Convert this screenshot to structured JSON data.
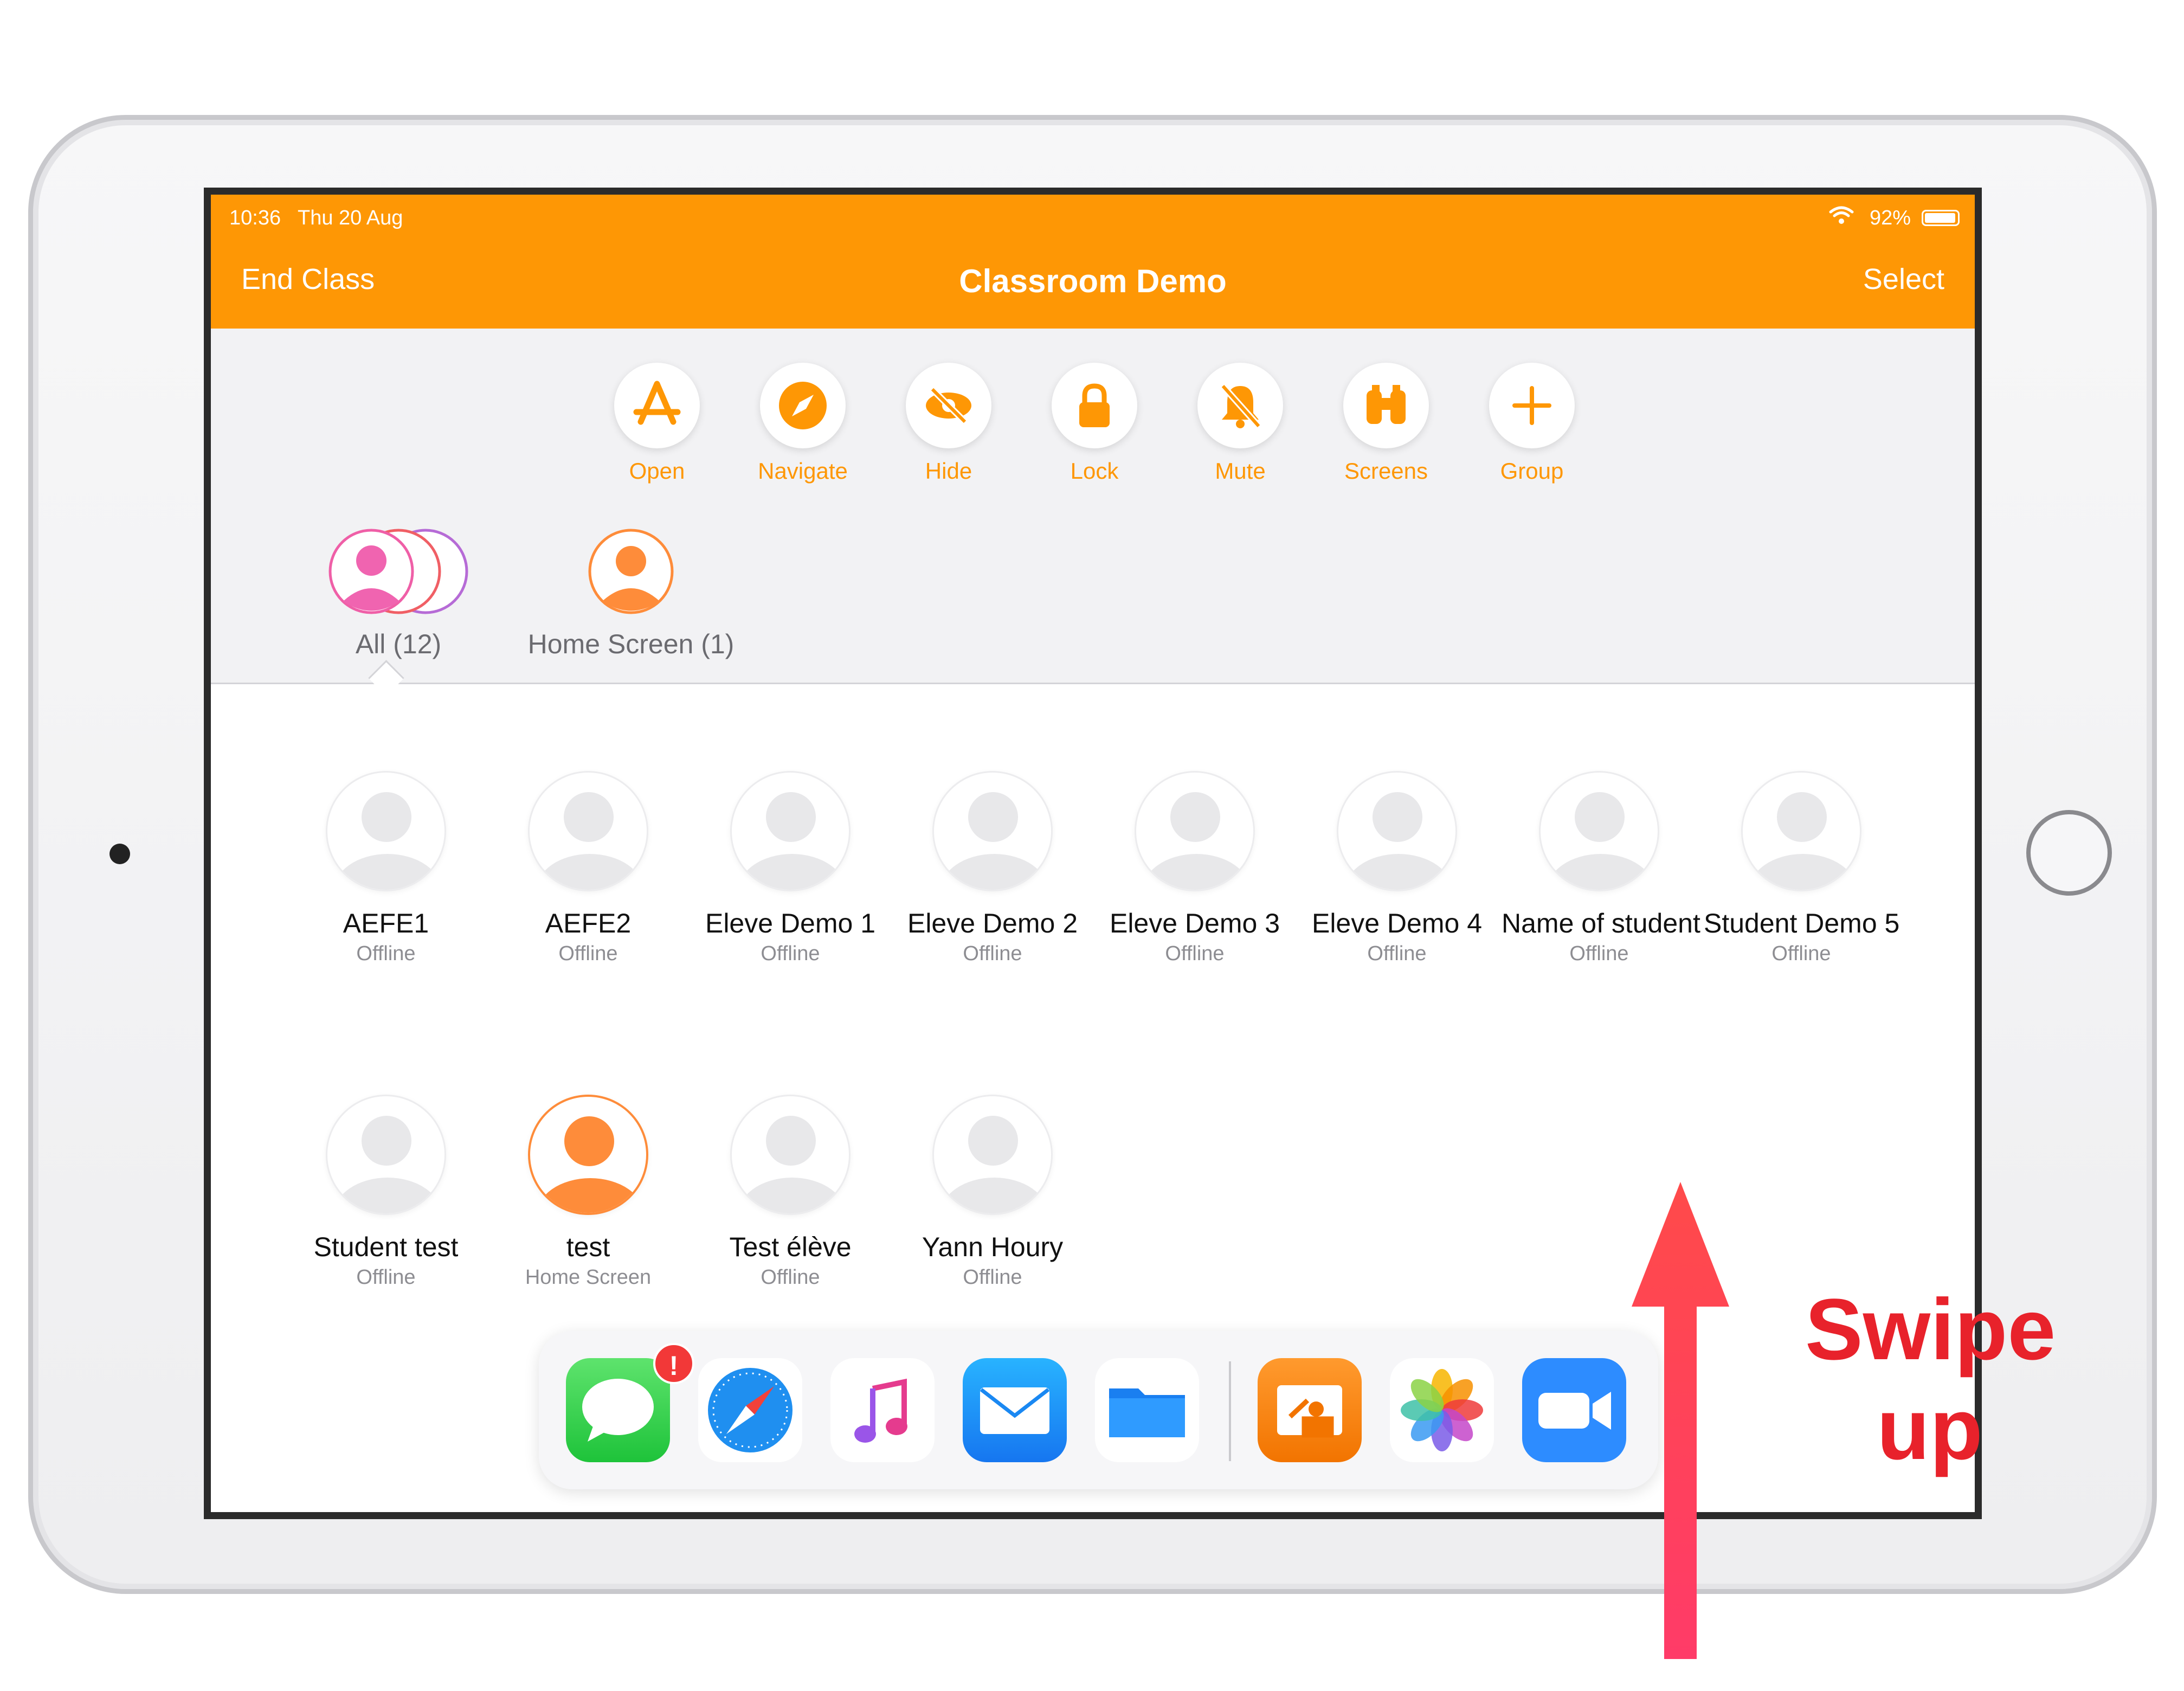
{
  "status_bar": {
    "time": "10:36",
    "date": "Thu 20 Aug",
    "battery": "92%"
  },
  "nav": {
    "left": "End Class",
    "title": "Classroom Demo",
    "right": "Select"
  },
  "toolbar": [
    {
      "label": "Open",
      "icon": "app-store-icon"
    },
    {
      "label": "Navigate",
      "icon": "compass-icon"
    },
    {
      "label": "Hide",
      "icon": "eye-slash-icon"
    },
    {
      "label": "Lock",
      "icon": "lock-icon"
    },
    {
      "label": "Mute",
      "icon": "bell-slash-icon"
    },
    {
      "label": "Screens",
      "icon": "binoculars-icon"
    },
    {
      "label": "Group",
      "icon": "plus-icon"
    }
  ],
  "groups": [
    {
      "label": "All (12)"
    },
    {
      "label": "Home Screen (1)"
    }
  ],
  "students": [
    {
      "name": "AEFE1",
      "status": "Offline"
    },
    {
      "name": "AEFE2",
      "status": "Offline"
    },
    {
      "name": "Eleve Demo 1",
      "status": "Offline"
    },
    {
      "name": "Eleve Demo 2",
      "status": "Offline"
    },
    {
      "name": "Eleve Demo 3",
      "status": "Offline"
    },
    {
      "name": "Eleve Demo 4",
      "status": "Offline"
    },
    {
      "name": "Name of student",
      "status": "Offline"
    },
    {
      "name": "Student Demo 5",
      "status": "Offline"
    },
    {
      "name": "Student test",
      "status": "Offline"
    },
    {
      "name": "test",
      "status": "Home Screen"
    },
    {
      "name": "Test élève",
      "status": "Offline"
    },
    {
      "name": "Yann Houry",
      "status": "Offline"
    }
  ],
  "dock": {
    "apps": [
      "messages-app-icon",
      "safari-app-icon",
      "music-app-icon",
      "mail-app-icon",
      "files-app-icon",
      "classroom-app-icon",
      "photos-app-icon",
      "zoom-app-icon"
    ],
    "messages_badge": "!"
  },
  "annotation": {
    "line1": "Swipe",
    "line2": "up",
    "color": "#e8222b"
  },
  "colors": {
    "accent": "#fe9705",
    "active_student": "#fe8c3a"
  }
}
